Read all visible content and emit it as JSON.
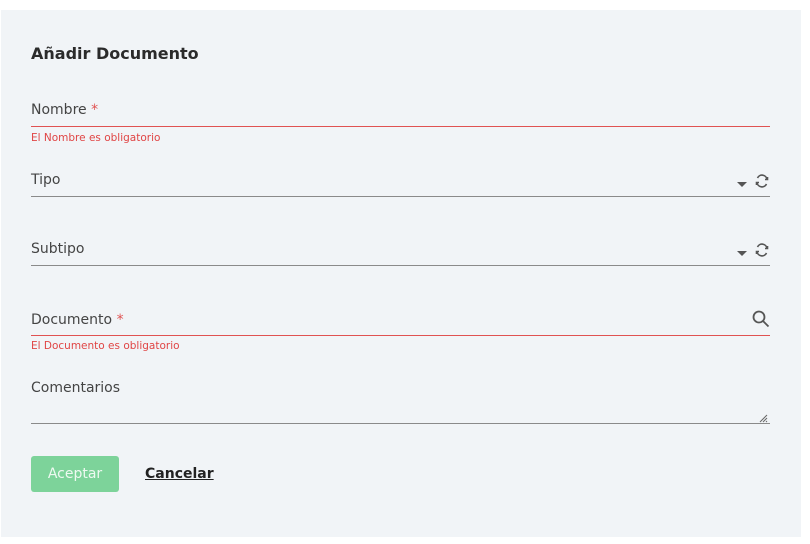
{
  "form": {
    "title": "Añadir Documento",
    "fields": {
      "nombre": {
        "label": "Nombre",
        "required_mark": "*",
        "error": "El Nombre es obligatorio"
      },
      "tipo": {
        "label": "Tipo"
      },
      "subtipo": {
        "label": "Subtipo"
      },
      "documento": {
        "label": "Documento",
        "required_mark": "*",
        "error": "El Documento es obligatorio"
      },
      "comentarios": {
        "label": "Comentarios"
      }
    },
    "buttons": {
      "accept": "Aceptar",
      "cancel": "Cancelar"
    }
  },
  "colors": {
    "error": "#e05252",
    "accept_bg": "#7dd39a",
    "panel_bg": "#f1f4f7"
  }
}
